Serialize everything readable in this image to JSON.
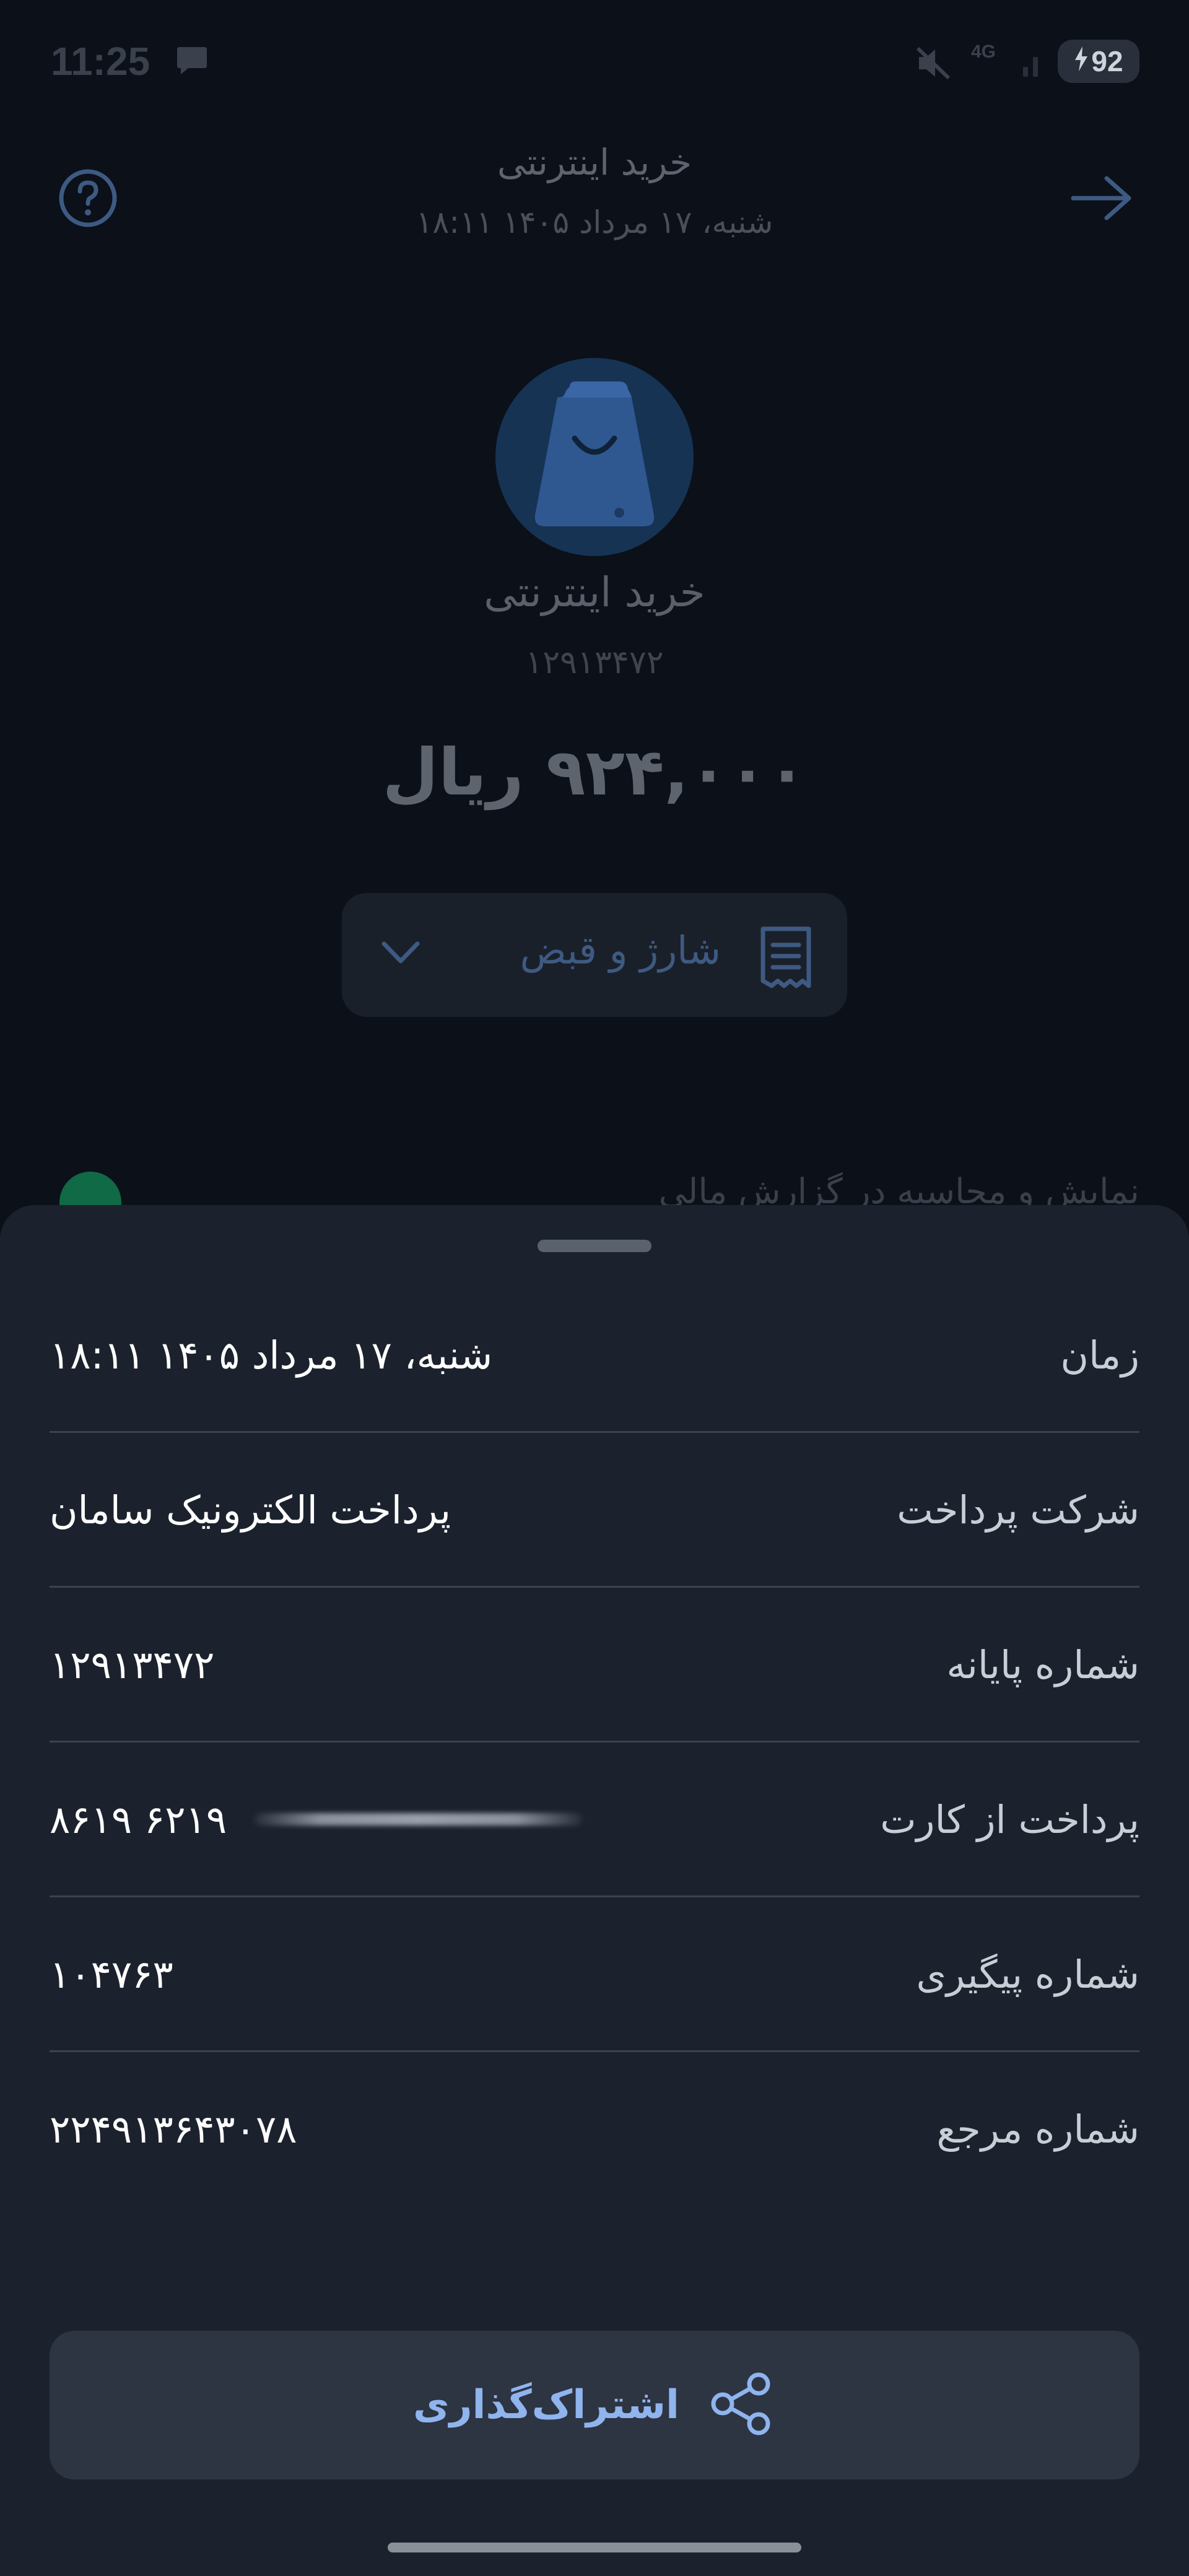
{
  "status_bar": {
    "time": "11:25",
    "network": "4G",
    "battery": "92"
  },
  "header": {
    "title": "خرید اینترنتی",
    "subtitle": "شنبه، ۱۷ مرداد ۱۴۰۵ ۱۸:۱۱"
  },
  "merchant": {
    "name": "خرید اینترنتی",
    "id": "۱۲۹۱۳۴۷۲",
    "amount": "۹۲۴,۰۰۰ ریال"
  },
  "category": {
    "label": "شارژ و قبض"
  },
  "background_row": {
    "text": "نمایش و محاسبه در گزارش مالی"
  },
  "details": [
    {
      "label": "زمان",
      "value": "شنبه، ۱۷ مرداد ۱۴۰۵ ۱۸:۱۱"
    },
    {
      "label": "شرکت پرداخت",
      "value": "پرداخت الکترونیک سامان"
    },
    {
      "label": "شماره پایانه",
      "value": "۱۲۹۱۳۴۷۲"
    },
    {
      "label": "پرداخت از کارت",
      "value": "۶۲۱۹ ۸۶۱۹"
    },
    {
      "label": "شماره پیگیری",
      "value": "۱۰۴۷۶۳"
    },
    {
      "label": "شماره مرجع",
      "value": "۲۲۴۹۱۳۶۴۳۰۷۸"
    }
  ],
  "share": {
    "label": "اشتراک‌گذاری"
  },
  "colors": {
    "background": "#0b1019",
    "sheet": "#1c222d",
    "accent": "#8fb4ee",
    "avatar": "#163354"
  }
}
